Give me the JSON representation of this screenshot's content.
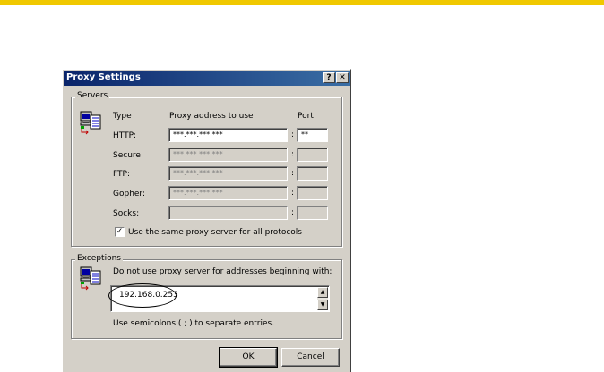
{
  "window": {
    "title": "Proxy Settings",
    "help_label": "?",
    "close_label": "✕"
  },
  "servers": {
    "group_label": "Servers",
    "icon": "network-computer-icon",
    "col_type": "Type",
    "col_address": "Proxy address to use",
    "col_port": "Port",
    "rows": [
      {
        "type": "HTTP:",
        "address": "***.***.***.***",
        "port": "**",
        "enabled": true
      },
      {
        "type": "Secure:",
        "address": "***.***.***.***",
        "port": "",
        "enabled": false
      },
      {
        "type": "FTP:",
        "address": "***.***.***.***",
        "port": "",
        "enabled": false
      },
      {
        "type": "Gopher:",
        "address": "***.***.***.***",
        "port": "",
        "enabled": false
      },
      {
        "type": "Socks:",
        "address": "",
        "port": "",
        "enabled": false
      }
    ],
    "separator": ":",
    "same_proxy_label": "Use the same proxy server for all protocols",
    "same_proxy_checked": true
  },
  "exceptions": {
    "group_label": "Exceptions",
    "icon": "network-computer-icon",
    "description": "Do not use proxy server for addresses beginning with:",
    "value": "192.168.0.253",
    "hint": "Use semicolons ( ; ) to separate entries."
  },
  "buttons": {
    "ok": "OK",
    "cancel": "Cancel"
  },
  "colors": {
    "accent_bar": "#f0c800",
    "titlebar_start": "#0a246a",
    "titlebar_end": "#3a6ea5",
    "dialog_bg": "#d4d0c8"
  }
}
